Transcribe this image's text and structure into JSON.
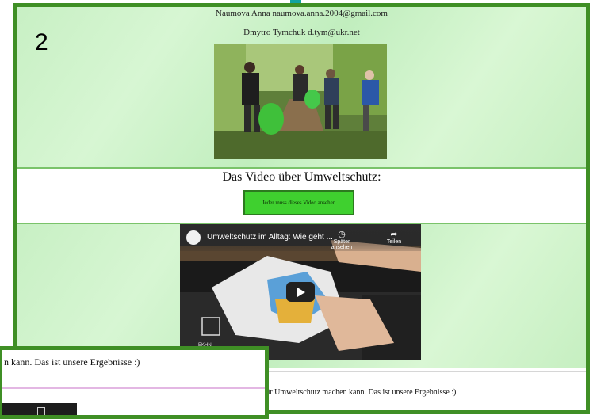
{
  "contacts": [
    "Naumova Anna naumova.anna.2004@gmail.com",
    "Dmytro Tymchuk d.tym@ukr.net"
  ],
  "slide_number": "2",
  "video_section": {
    "title": "Das Video über Umweltschutz:",
    "watch_button": "Jeder muss dieses Video ansehen"
  },
  "video": {
    "title": "Umweltschutz im Alltag: Wie geht ...",
    "watch_later": "Später ansehen",
    "share": "Teilen",
    "channel_logo_text": "EKHN"
  },
  "results_text": "für Umweltschutz machen kann. Das ist unsere Ergebnisse :)",
  "inset": {
    "text": "n kann. Das ist unsere Ergebnisse :)"
  },
  "colors": {
    "frame": "#3f8f25",
    "accent_teal": "#12a4a0",
    "button": "#3fd02f",
    "background_green": "#cdf2c9"
  }
}
